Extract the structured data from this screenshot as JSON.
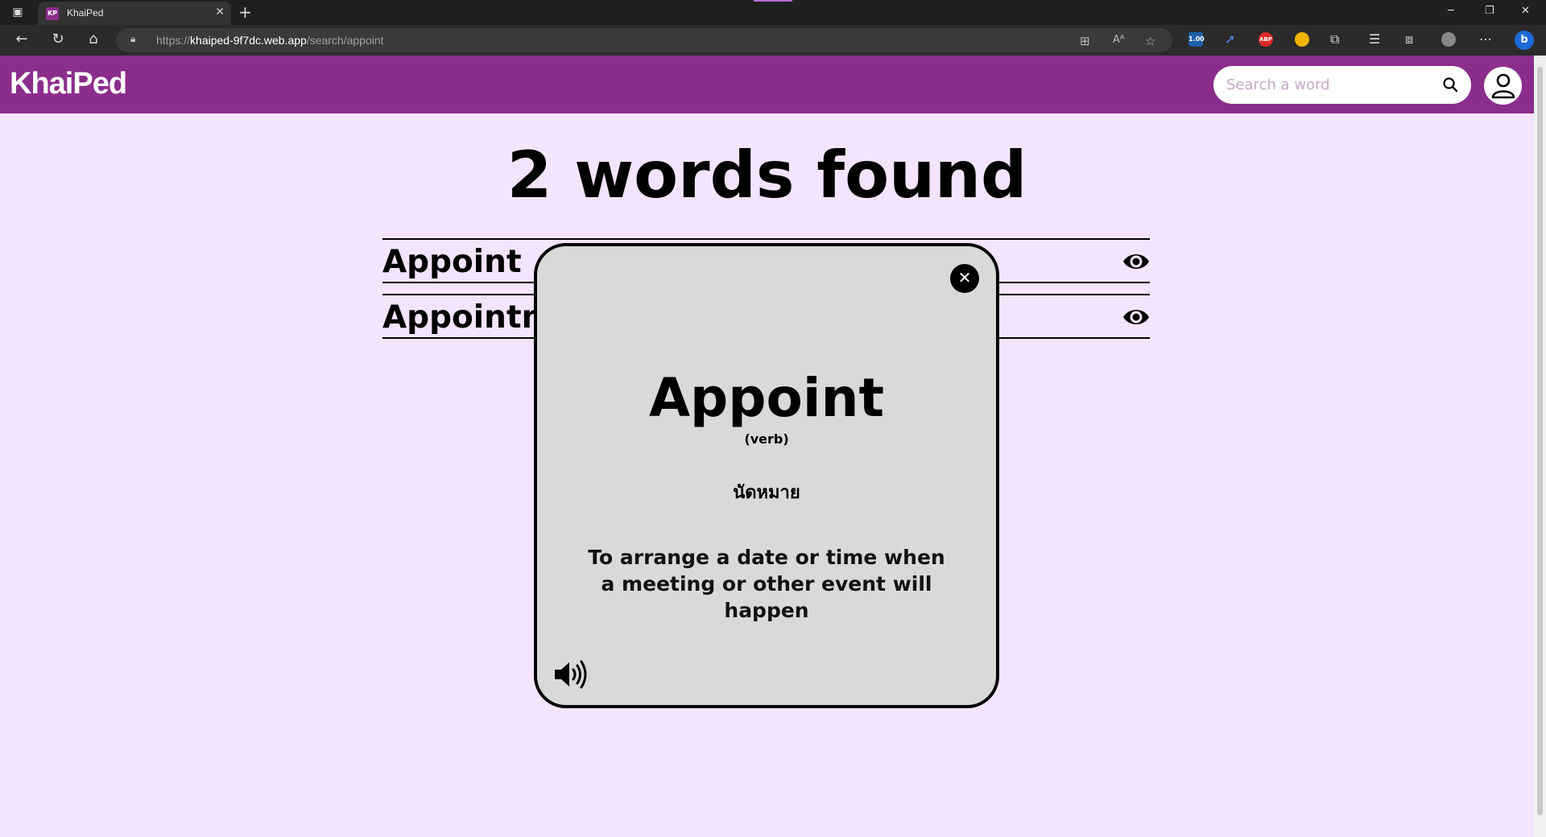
{
  "browser": {
    "tab_title": "KhaiPed",
    "tab_favicon": "KP",
    "url_prefix": "https://",
    "url_host": "khaiped-9f7dc.web.app",
    "url_path": "/search/appoint",
    "ext_badge": "1.00",
    "ext_abp": "ABP"
  },
  "header": {
    "logo": "KhaiPed",
    "search_placeholder": "Search a word"
  },
  "results": {
    "title": "2 words found",
    "words": [
      {
        "label": "Appoint"
      },
      {
        "label": "Appointme"
      }
    ]
  },
  "modal": {
    "word": "Appoint",
    "part_of_speech": "(verb)",
    "thai": "นัดหมาย",
    "definition": "To arrange a date or time when a meeting or other event will happen"
  },
  "colors": {
    "brand": "#8b2d8b",
    "page_bg": "#f4e4ff",
    "modal_bg": "#d9d9d9"
  }
}
